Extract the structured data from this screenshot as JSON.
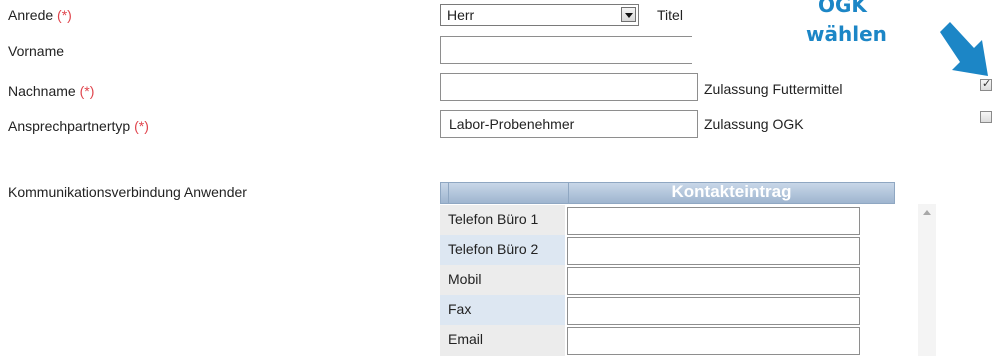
{
  "form": {
    "anrede": {
      "label": "Anrede",
      "required": "(*)",
      "value": "Herr"
    },
    "titel": {
      "label": "Titel"
    },
    "vorname": {
      "label": "Vorname",
      "value": ""
    },
    "nachname": {
      "label": "Nachname",
      "required": "(*)",
      "value": ""
    },
    "ansprechpartnertyp": {
      "label": "Ansprechpartnertyp",
      "required": "(*)",
      "value": "Labor-Probenehmer"
    },
    "zulassung_futtermittel": {
      "label": "Zulassung Futtermittel",
      "checked": true
    },
    "zulassung_ogk": {
      "label": "Zulassung OGK",
      "checked": false
    },
    "kommunikation_label": "Kommunikationsverbindung Anwender"
  },
  "annotation": {
    "line1": "OGK",
    "line2": "wählen",
    "color": "#1c86c6"
  },
  "contact_grid": {
    "header": "Kontakteintrag",
    "rows": [
      {
        "label": "Telefon Büro 1",
        "value": ""
      },
      {
        "label": "Telefon Büro 2",
        "value": ""
      },
      {
        "label": "Mobil",
        "value": ""
      },
      {
        "label": "Fax",
        "value": ""
      },
      {
        "label": "Email",
        "value": ""
      }
    ]
  }
}
